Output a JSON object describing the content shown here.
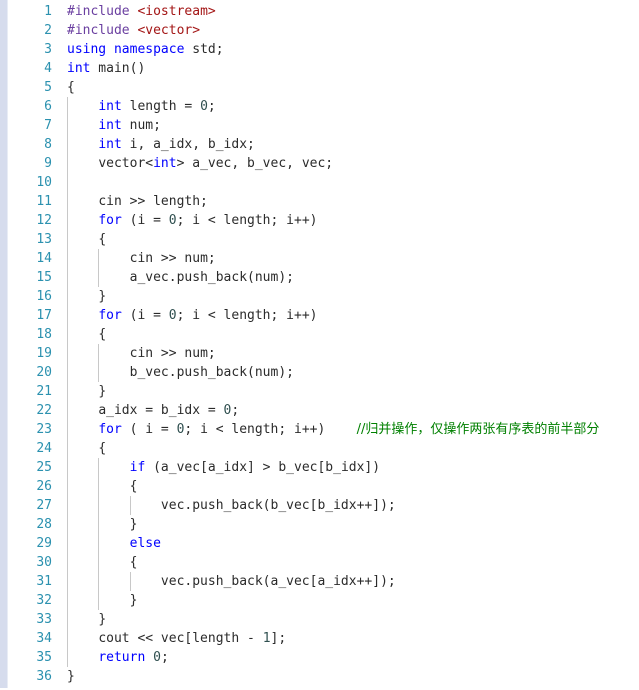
{
  "editor": {
    "language": "C++",
    "total_lines": 36,
    "colors": {
      "background": "#ffffff",
      "line_number": "#2b91af",
      "keyword": "#0000ff",
      "preprocessor": "#6a3fa0",
      "header_literal": "#a31515",
      "number": "#2f4f4f",
      "identifier": "#2b2b2b",
      "comment": "#008000",
      "indent_guide": "#c8c8c8",
      "left_margin_strip": "#d6dced"
    },
    "line_numbers": [
      "1",
      "2",
      "3",
      "4",
      "5",
      "6",
      "7",
      "8",
      "9",
      "10",
      "11",
      "12",
      "13",
      "14",
      "15",
      "16",
      "17",
      "18",
      "19",
      "20",
      "21",
      "22",
      "23",
      "24",
      "25",
      "26",
      "27",
      "28",
      "29",
      "30",
      "31",
      "32",
      "33",
      "34",
      "35",
      "36"
    ],
    "lines": [
      {
        "n": "1",
        "indent": 0,
        "guides": 0,
        "tokens": [
          {
            "t": "#include",
            "c": "pp"
          },
          {
            "t": " ",
            "c": "id"
          },
          {
            "t": "<iostream>",
            "c": "hdr"
          }
        ]
      },
      {
        "n": "2",
        "indent": 0,
        "guides": 0,
        "tokens": [
          {
            "t": "#include",
            "c": "pp"
          },
          {
            "t": " ",
            "c": "id"
          },
          {
            "t": "<vector>",
            "c": "hdr"
          }
        ]
      },
      {
        "n": "3",
        "indent": 0,
        "guides": 0,
        "tokens": [
          {
            "t": "using",
            "c": "kw"
          },
          {
            "t": " ",
            "c": "id"
          },
          {
            "t": "namespace",
            "c": "kw"
          },
          {
            "t": " std;",
            "c": "id"
          }
        ]
      },
      {
        "n": "4",
        "indent": 0,
        "guides": 0,
        "tokens": [
          {
            "t": "int",
            "c": "kw"
          },
          {
            "t": " main()",
            "c": "id"
          }
        ]
      },
      {
        "n": "5",
        "indent": 0,
        "guides": 0,
        "tokens": [
          {
            "t": "{",
            "c": "id"
          }
        ]
      },
      {
        "n": "6",
        "indent": 1,
        "guides": 1,
        "tokens": [
          {
            "t": "int",
            "c": "kw"
          },
          {
            "t": " length = ",
            "c": "id"
          },
          {
            "t": "0",
            "c": "num"
          },
          {
            "t": ";",
            "c": "id"
          }
        ]
      },
      {
        "n": "7",
        "indent": 1,
        "guides": 1,
        "tokens": [
          {
            "t": "int",
            "c": "kw"
          },
          {
            "t": " num;",
            "c": "id"
          }
        ]
      },
      {
        "n": "8",
        "indent": 1,
        "guides": 1,
        "tokens": [
          {
            "t": "int",
            "c": "kw"
          },
          {
            "t": " i, a_idx, b_idx;",
            "c": "id"
          }
        ]
      },
      {
        "n": "9",
        "indent": 1,
        "guides": 1,
        "tokens": [
          {
            "t": "vector<",
            "c": "id"
          },
          {
            "t": "int",
            "c": "kw"
          },
          {
            "t": "> a_vec, b_vec, vec;",
            "c": "id"
          }
        ]
      },
      {
        "n": "10",
        "indent": 0,
        "guides": 1,
        "tokens": []
      },
      {
        "n": "11",
        "indent": 1,
        "guides": 1,
        "tokens": [
          {
            "t": "cin >> length;",
            "c": "id"
          }
        ]
      },
      {
        "n": "12",
        "indent": 1,
        "guides": 1,
        "tokens": [
          {
            "t": "for",
            "c": "kw"
          },
          {
            "t": " (i = ",
            "c": "id"
          },
          {
            "t": "0",
            "c": "num"
          },
          {
            "t": "; i < length; i++)",
            "c": "id"
          }
        ]
      },
      {
        "n": "13",
        "indent": 1,
        "guides": 1,
        "tokens": [
          {
            "t": "{",
            "c": "id"
          }
        ]
      },
      {
        "n": "14",
        "indent": 2,
        "guides": 2,
        "tokens": [
          {
            "t": "cin >> num;",
            "c": "id"
          }
        ]
      },
      {
        "n": "15",
        "indent": 2,
        "guides": 2,
        "tokens": [
          {
            "t": "a_vec.push_back(num);",
            "c": "id"
          }
        ]
      },
      {
        "n": "16",
        "indent": 1,
        "guides": 1,
        "tokens": [
          {
            "t": "}",
            "c": "id"
          }
        ]
      },
      {
        "n": "17",
        "indent": 1,
        "guides": 1,
        "tokens": [
          {
            "t": "for",
            "c": "kw"
          },
          {
            "t": " (i = ",
            "c": "id"
          },
          {
            "t": "0",
            "c": "num"
          },
          {
            "t": "; i < length; i++)",
            "c": "id"
          }
        ]
      },
      {
        "n": "18",
        "indent": 1,
        "guides": 1,
        "tokens": [
          {
            "t": "{",
            "c": "id"
          }
        ]
      },
      {
        "n": "19",
        "indent": 2,
        "guides": 2,
        "tokens": [
          {
            "t": "cin >> num;",
            "c": "id"
          }
        ]
      },
      {
        "n": "20",
        "indent": 2,
        "guides": 2,
        "tokens": [
          {
            "t": "b_vec.push_back(num);",
            "c": "id"
          }
        ]
      },
      {
        "n": "21",
        "indent": 1,
        "guides": 1,
        "tokens": [
          {
            "t": "}",
            "c": "id"
          }
        ]
      },
      {
        "n": "22",
        "indent": 1,
        "guides": 1,
        "tokens": [
          {
            "t": "a_idx = b_idx = ",
            "c": "id"
          },
          {
            "t": "0",
            "c": "num"
          },
          {
            "t": ";",
            "c": "id"
          }
        ]
      },
      {
        "n": "23",
        "indent": 1,
        "guides": 1,
        "tokens": [
          {
            "t": "for",
            "c": "kw"
          },
          {
            "t": " ( i = ",
            "c": "id"
          },
          {
            "t": "0",
            "c": "num"
          },
          {
            "t": "; i < length; i++)",
            "c": "id"
          },
          {
            "t": "    ",
            "c": "id"
          },
          {
            "t": "//归并操作，仅操作两张有序表的前半部分",
            "c": "cmt"
          }
        ]
      },
      {
        "n": "24",
        "indent": 1,
        "guides": 1,
        "tokens": [
          {
            "t": "{",
            "c": "id"
          }
        ]
      },
      {
        "n": "25",
        "indent": 2,
        "guides": 2,
        "tokens": [
          {
            "t": "if",
            "c": "kw"
          },
          {
            "t": " (a_vec[a_idx] > b_vec[b_idx])",
            "c": "id"
          }
        ]
      },
      {
        "n": "26",
        "indent": 2,
        "guides": 2,
        "tokens": [
          {
            "t": "{",
            "c": "id"
          }
        ]
      },
      {
        "n": "27",
        "indent": 3,
        "guides": 3,
        "tokens": [
          {
            "t": "vec.push_back(b_vec[b_idx++]);",
            "c": "id"
          }
        ]
      },
      {
        "n": "28",
        "indent": 2,
        "guides": 2,
        "tokens": [
          {
            "t": "}",
            "c": "id"
          }
        ]
      },
      {
        "n": "29",
        "indent": 2,
        "guides": 2,
        "tokens": [
          {
            "t": "else",
            "c": "kw"
          }
        ]
      },
      {
        "n": "30",
        "indent": 2,
        "guides": 2,
        "tokens": [
          {
            "t": "{",
            "c": "id"
          }
        ]
      },
      {
        "n": "31",
        "indent": 3,
        "guides": 3,
        "tokens": [
          {
            "t": "vec.push_back(a_vec[a_idx++]);",
            "c": "id"
          }
        ]
      },
      {
        "n": "32",
        "indent": 2,
        "guides": 2,
        "tokens": [
          {
            "t": "}",
            "c": "id"
          }
        ]
      },
      {
        "n": "33",
        "indent": 1,
        "guides": 1,
        "tokens": [
          {
            "t": "}",
            "c": "id"
          }
        ]
      },
      {
        "n": "34",
        "indent": 1,
        "guides": 1,
        "tokens": [
          {
            "t": "cout << vec[length - ",
            "c": "id"
          },
          {
            "t": "1",
            "c": "num"
          },
          {
            "t": "];",
            "c": "id"
          }
        ]
      },
      {
        "n": "35",
        "indent": 1,
        "guides": 1,
        "tokens": [
          {
            "t": "return",
            "c": "kw"
          },
          {
            "t": " ",
            "c": "id"
          },
          {
            "t": "0",
            "c": "num"
          },
          {
            "t": ";",
            "c": "id"
          }
        ]
      },
      {
        "n": "36",
        "indent": 0,
        "guides": 0,
        "tokens": [
          {
            "t": "}",
            "c": "id"
          }
        ]
      }
    ]
  }
}
